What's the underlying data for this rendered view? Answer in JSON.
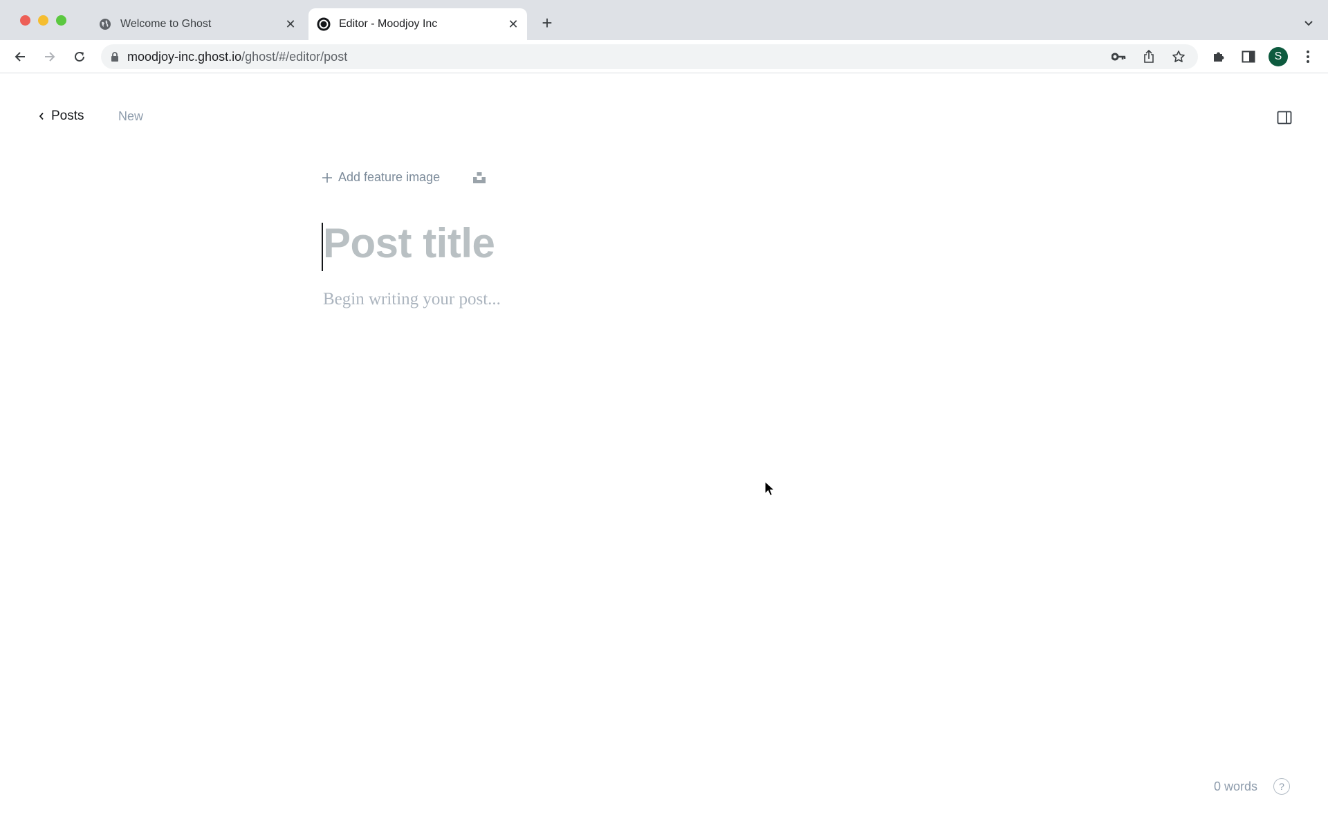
{
  "browser": {
    "tabs": [
      {
        "title": "Welcome to Ghost",
        "icon": "globe-icon",
        "active": false
      },
      {
        "title": "Editor - Moodjoy Inc",
        "icon": "ghost-logo-icon",
        "active": true
      }
    ],
    "new_tab_label": "+",
    "url_domain": "moodjoy-inc.ghost.io",
    "url_path": "/ghost/#/editor/post",
    "profile_initial": "S",
    "profile_color": "#0d5a3e"
  },
  "editor": {
    "back_label": "Posts",
    "status": "New",
    "add_feature_image": "Add feature image",
    "title_placeholder": "Post title",
    "body_placeholder": "Begin writing your post...",
    "word_count": "0 words",
    "help_label": "?"
  }
}
